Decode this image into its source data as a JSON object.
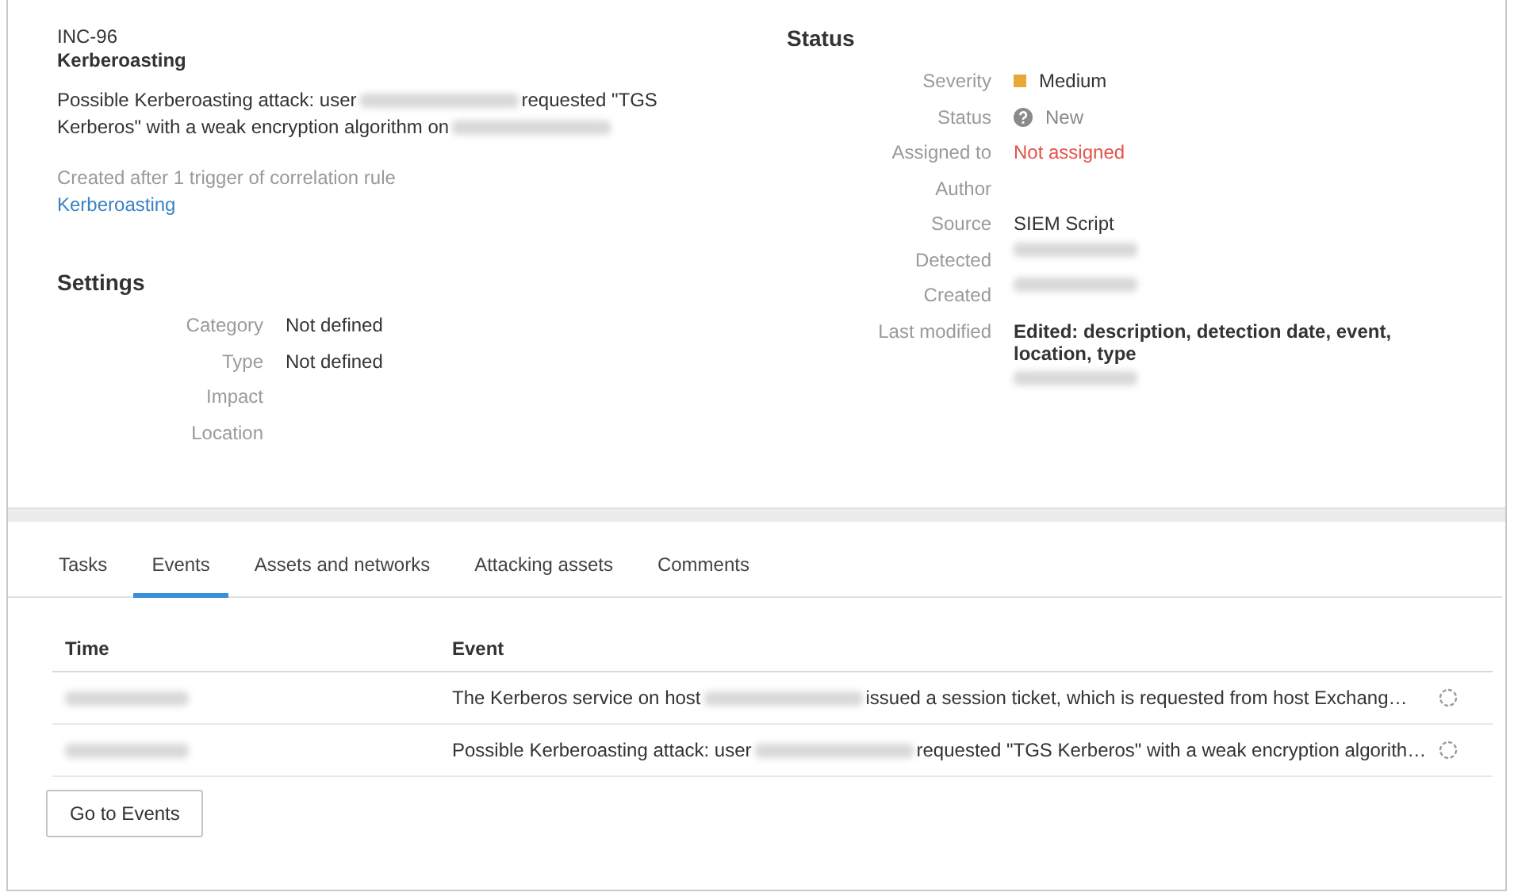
{
  "incident": {
    "id": "INC-96",
    "title": "Kerberoasting",
    "description": [
      [
        {
          "kind": "text",
          "text": "Possible Kerberoasting attack: user "
        },
        {
          "kind": "redacted"
        },
        {
          "kind": "text",
          "text": "requested \"TGS"
        }
      ],
      [
        {
          "kind": "text",
          "text": "Kerberos\" with a weak encryption algorithm on"
        },
        {
          "kind": "redacted"
        }
      ]
    ],
    "origin": "Created after 1 trigger of correlation rule",
    "rule_link": "Kerberoasting"
  },
  "settings": {
    "title": "Settings",
    "fields": [
      {
        "label": "Category",
        "value": "Not defined"
      },
      {
        "label": "Type",
        "value": "Not defined"
      },
      {
        "label": "Impact"
      },
      {
        "label": "Location"
      }
    ]
  },
  "status": {
    "title": "Status",
    "fields": [
      {
        "label": "Severity",
        "kind": "severity",
        "value": "Medium",
        "color": "#e8a838"
      },
      {
        "label": "Status",
        "kind": "status",
        "value": "New"
      },
      {
        "label": "Assigned to",
        "kind": "warning",
        "value": "Not assigned"
      },
      {
        "label": "Author",
        "kind": "empty"
      },
      {
        "label": "Source",
        "kind": "text",
        "value": "SIEM Script"
      },
      {
        "label": "Detected",
        "kind": "redacted"
      },
      {
        "label": "Created",
        "kind": "redacted"
      },
      {
        "label": "Last modified",
        "kind": "modified",
        "value": "Edited: description, detection date, event, location, type"
      }
    ]
  },
  "tabs": [
    {
      "label": "Tasks",
      "selected": false
    },
    {
      "label": "Events",
      "selected": true
    },
    {
      "label": "Assets and networks",
      "selected": false
    },
    {
      "label": "Attacking assets",
      "selected": false
    },
    {
      "label": "Comments",
      "selected": false
    }
  ],
  "table": {
    "columns": [
      "Time",
      "Event"
    ],
    "rows": [
      {
        "event": [
          {
            "kind": "text",
            "text": "The Kerberos service on host"
          },
          {
            "kind": "redacted"
          },
          {
            "kind": "text",
            "text": " issued a session ticket, which is requested from host Exchang…"
          }
        ]
      },
      {
        "event": [
          {
            "kind": "text",
            "text": "Possible Kerberoasting attack: user "
          },
          {
            "kind": "redacted"
          },
          {
            "kind": "text",
            "text": "requested \"TGS Kerberos\" with a weak encryption algorith…"
          }
        ]
      }
    ]
  },
  "button": "Go to Events"
}
